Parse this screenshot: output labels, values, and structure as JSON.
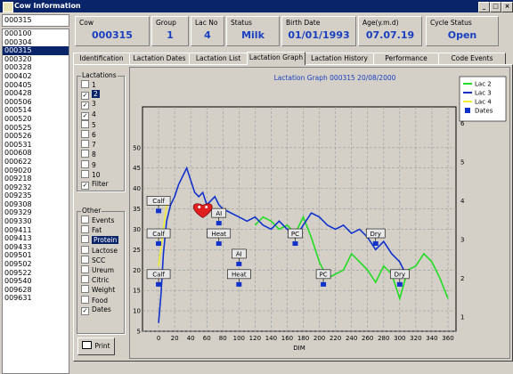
{
  "window": {
    "title": "Cow Information",
    "controls": [
      "_",
      "□",
      "×"
    ]
  },
  "left": {
    "cow_input": "000315",
    "cow_list": [
      "000100",
      "000304",
      "000315",
      "000320",
      "000328",
      "000402",
      "000405",
      "000428",
      "000506",
      "000514",
      "000520",
      "000525",
      "000526",
      "000531",
      "000608",
      "000622",
      "009020",
      "009218",
      "009232",
      "009235",
      "009308",
      "009329",
      "009330",
      "009411",
      "009413",
      "009433",
      "009501",
      "009502",
      "009522",
      "009540",
      "009628",
      "009631"
    ],
    "selected_index": 2
  },
  "header": {
    "cow": {
      "label": "Cow",
      "value": "000315"
    },
    "group": {
      "label": "Group",
      "value": "1"
    },
    "lac_no": {
      "label": "Lac No",
      "value": "4"
    },
    "status": {
      "label": "Status",
      "value": "Milk"
    },
    "birth_date": {
      "label": "Birth Date",
      "value": "01/01/1993"
    },
    "age": {
      "label": "Age(y.m.d)",
      "value": "07.07.19"
    },
    "cycle_status": {
      "label": "Cycle Status",
      "value": "Open"
    }
  },
  "tabs": [
    "Identification",
    "Lactation Dates",
    "Lactation List",
    "Lactation Graph",
    "Lactation History",
    "Performance",
    "Code Events"
  ],
  "active_tab": 3,
  "lactations": {
    "label": "Lactations",
    "items": [
      {
        "label": "1",
        "checked": false
      },
      {
        "label": "2",
        "checked": true,
        "selected": true
      },
      {
        "label": "3",
        "checked": true
      },
      {
        "label": "4",
        "checked": true
      },
      {
        "label": "5",
        "checked": false
      },
      {
        "label": "6",
        "checked": false
      },
      {
        "label": "7",
        "checked": false
      },
      {
        "label": "8",
        "checked": false
      },
      {
        "label": "9",
        "checked": false
      },
      {
        "label": "10",
        "checked": false
      },
      {
        "label": "Filter",
        "checked": true
      }
    ]
  },
  "other": {
    "label": "Other",
    "items": [
      {
        "label": "Events",
        "checked": false
      },
      {
        "label": "Fat",
        "checked": false
      },
      {
        "label": "Protein",
        "checked": false,
        "selected": true
      },
      {
        "label": "Lactose",
        "checked": false
      },
      {
        "label": "SCC",
        "checked": false
      },
      {
        "label": "Ureum",
        "checked": false
      },
      {
        "label": "Citric",
        "checked": false
      },
      {
        "label": "Weight",
        "checked": false
      },
      {
        "label": "Food",
        "checked": false
      },
      {
        "label": "Dates",
        "checked": true
      }
    ]
  },
  "print_label": "Print",
  "check_mark": "✓",
  "chart_data": {
    "type": "line",
    "title": "Lactation Graph 000315  20/08/2000",
    "xlabel": "DIM",
    "xlim": [
      -20,
      370
    ],
    "ylim": [
      5,
      60
    ],
    "x_ticks": [
      0,
      20,
      40,
      60,
      80,
      100,
      120,
      140,
      160,
      180,
      200,
      220,
      240,
      260,
      280,
      300,
      320,
      340,
      360
    ],
    "y_ticks": [
      5,
      10,
      15,
      20,
      25,
      30,
      35,
      40,
      45,
      50
    ],
    "right_ticks": [
      {
        "label": "1",
        "y": 8.5
      },
      {
        "label": "2",
        "y": 18.0
      },
      {
        "label": "3",
        "y": 27.5
      },
      {
        "label": "4",
        "y": 37.0
      },
      {
        "label": "5",
        "y": 46.5
      },
      {
        "label": "6",
        "y": 56.0
      }
    ],
    "grid": true,
    "legend_position": "top-right",
    "series": [
      {
        "name": "Lac 2",
        "color": "#22dd22",
        "x": [
          120,
          130,
          140,
          150,
          160,
          170,
          180,
          190,
          200,
          210,
          220,
          230,
          240,
          250,
          260,
          270,
          280,
          290,
          300,
          310,
          320,
          330,
          340,
          350,
          360
        ],
        "y": [
          31,
          33,
          32,
          30,
          31,
          29,
          33,
          28,
          22,
          18,
          19,
          20,
          24,
          22,
          20,
          17,
          21,
          19,
          13,
          20,
          21,
          24,
          22,
          18,
          13
        ]
      },
      {
        "name": "Lac 3",
        "color": "#1133cc",
        "x": [
          0,
          3,
          6,
          10,
          15,
          20,
          25,
          30,
          35,
          40,
          45,
          50,
          55,
          60,
          65,
          70,
          75,
          80,
          90,
          100,
          110,
          120,
          130,
          140,
          150,
          160,
          170,
          180,
          190,
          200,
          210,
          220,
          230,
          240,
          250,
          260,
          270,
          280,
          290,
          300,
          310
        ],
        "y": [
          7,
          14,
          24,
          32,
          36,
          38,
          41,
          43,
          45,
          42,
          39,
          38,
          39,
          36,
          37,
          38,
          36,
          35,
          34,
          33,
          32,
          33,
          31,
          30,
          32,
          30,
          28,
          31,
          34,
          33,
          31,
          30,
          31,
          29,
          30,
          28,
          25,
          27,
          24,
          22,
          18
        ]
      },
      {
        "name": "Lac 4",
        "color": "#eeee33",
        "x": [
          0,
          2,
          4,
          6,
          8,
          10
        ],
        "y": [
          21,
          24,
          27,
          30,
          33,
          36
        ]
      }
    ],
    "dates_series": {
      "name": "Dates",
      "color": "#1133cc"
    },
    "annotations": [
      {
        "label": "Calf",
        "x": 0,
        "y": 37
      },
      {
        "label": "Calf",
        "x": 0,
        "y": 29
      },
      {
        "label": "Calf",
        "x": 0,
        "y": 19
      },
      {
        "label": "AI",
        "x": 75,
        "y": 34
      },
      {
        "label": "Heat",
        "x": 75,
        "y": 29
      },
      {
        "label": "AI",
        "x": 100,
        "y": 24
      },
      {
        "label": "Heat",
        "x": 100,
        "y": 19
      },
      {
        "label": "PC",
        "x": 170,
        "y": 29
      },
      {
        "label": "PC",
        "x": 205,
        "y": 19
      },
      {
        "label": "Dry",
        "x": 270,
        "y": 29
      },
      {
        "label": "Dry",
        "x": 300,
        "y": 19
      }
    ]
  }
}
